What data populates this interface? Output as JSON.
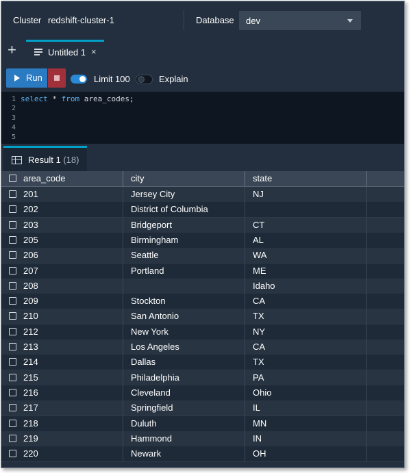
{
  "header": {
    "cluster_label": "Cluster",
    "cluster_value": "redshift-cluster-1",
    "database_label": "Database",
    "database_value": "dev"
  },
  "tabs": {
    "new_tab_symbol": "+",
    "active_tab_label": "Untitled 1",
    "close_symbol": "×"
  },
  "toolbar": {
    "run_label": "Run",
    "limit_label": "Limit 100",
    "limit_enabled": true,
    "explain_label": "Explain",
    "explain_enabled": false
  },
  "editor": {
    "line_numbers": [
      "1",
      "2",
      "3",
      "4",
      "5"
    ],
    "query_keyword_select": "select",
    "query_star": " * ",
    "query_keyword_from": "from",
    "query_rest": " area_codes;"
  },
  "results": {
    "tab_label": "Result 1",
    "row_count": "(18)",
    "columns": [
      "area_code",
      "city",
      "state"
    ],
    "rows": [
      [
        "201",
        "Jersey City",
        "NJ"
      ],
      [
        "202",
        "District of Columbia",
        ""
      ],
      [
        "203",
        "Bridgeport",
        "CT"
      ],
      [
        "205",
        "Birmingham",
        "AL"
      ],
      [
        "206",
        "Seattle",
        "WA"
      ],
      [
        "207",
        "Portland",
        "ME"
      ],
      [
        "208",
        "",
        "Idaho"
      ],
      [
        "209",
        "Stockton",
        "CA"
      ],
      [
        "210",
        "San Antonio",
        "TX"
      ],
      [
        "212",
        "New York",
        "NY"
      ],
      [
        "213",
        "Los Angeles",
        "CA"
      ],
      [
        "214",
        "Dallas",
        "TX"
      ],
      [
        "215",
        "Philadelphia",
        "PA"
      ],
      [
        "216",
        "Cleveland",
        "Ohio"
      ],
      [
        "217",
        "Springfield",
        "IL"
      ],
      [
        "218",
        "Duluth",
        "MN"
      ],
      [
        "219",
        "Hammond",
        "IN"
      ],
      [
        "220",
        "Newark",
        "OH"
      ]
    ]
  },
  "colors": {
    "background": "#232f3e",
    "editor_bg": "#0e1621",
    "accent": "#00a1c9",
    "run_button": "#2b7bc3",
    "stop_button": "#a0313a",
    "sql_keyword": "#5fb3f0"
  }
}
